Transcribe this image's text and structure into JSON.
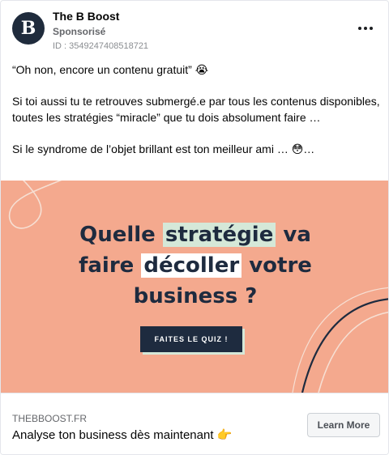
{
  "header": {
    "avatar_letter": "B",
    "page_name": "The B Boost",
    "sponsored_label": "Sponsorisé",
    "ad_id": "ID : 3549247408518721",
    "more_icon": "more-horizontal-icon"
  },
  "body": {
    "line1": "“Oh non, encore un contenu gratuit” 😭",
    "line2": "Si toi aussi tu te retrouves submergé.e par tous les contenus disponibles, toutes les stratégies “miracle” que tu dois absolument faire …",
    "line3": "Si le syndrome de l’objet brillant est ton meilleur ami … 😳…"
  },
  "banner": {
    "background_color": "#f4a98e",
    "text_color": "#1e2b3f",
    "highlight_color": "#d5e8d8",
    "headline_1a": "Quelle ",
    "headline_1b": "stratégie",
    "headline_1c": " va",
    "headline_2a": "faire ",
    "headline_2b": "décoller",
    "headline_2c": " votre",
    "headline_3": "business ?",
    "cta_label": "FAITES LE QUIZ !"
  },
  "footer": {
    "domain": "THEBBOOST.FR",
    "headline": "Analyse ton business dès maintenant 👉",
    "button_label": "Learn More"
  }
}
